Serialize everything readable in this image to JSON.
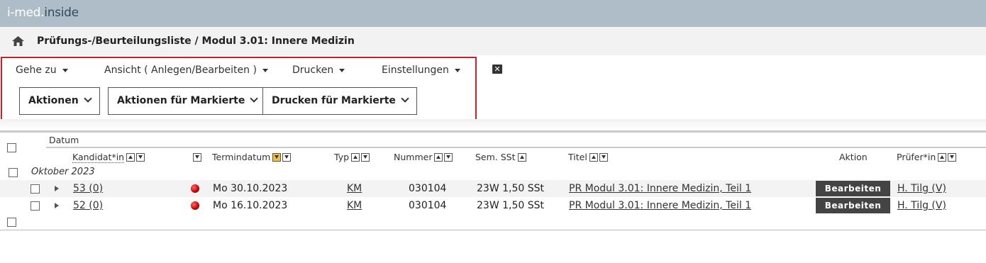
{
  "app": {
    "logo_part1": "i-med.",
    "logo_part2": "inside"
  },
  "breadcrumb": {
    "title": "Prüfungs-/Beurteilungsliste / Modul 3.01: Innere Medizin"
  },
  "menu": {
    "goto": "Gehe zu",
    "view": "Ansicht ( Anlegen/Bearbeiten )",
    "print": "Drucken",
    "settings": "Einstellungen",
    "close": "✕"
  },
  "buttons": {
    "actions": "Aktionen",
    "actions_marked": "Aktionen für Markierte",
    "print_marked": "Drucken für Markierte"
  },
  "table": {
    "group_header": "Datum",
    "columns": {
      "candidate": "Kandidat*in",
      "date": "Termindatum",
      "type": "Typ",
      "number": "Nummer",
      "semester": "Sem. SSt",
      "title": "Titel",
      "action": "Aktion",
      "examiner": "Prüfer*in"
    },
    "month": "Oktober 2023",
    "rows": [
      {
        "candidate": "53 (0)",
        "date": "Mo 30.10.2023",
        "type": "KM",
        "number": "030104",
        "semester": "23W 1,50 SSt",
        "title": "PR Modul 3.01: Innere Medizin, Teil 1",
        "action": "Bearbeiten",
        "examiner": "H. Tilg (V)"
      },
      {
        "candidate": "52 (0)",
        "date": "Mo 16.10.2023",
        "type": "KM",
        "number": "030104",
        "semester": "23W 1,50 SSt",
        "title": "PR Modul 3.01: Innere Medizin, Teil 1",
        "action": "Bearbeiten",
        "examiner": "H. Tilg (V)"
      }
    ]
  },
  "colors": {
    "topbar": "#aebdc7",
    "highlight_border": "#c8202a",
    "action_button": "#444444"
  }
}
